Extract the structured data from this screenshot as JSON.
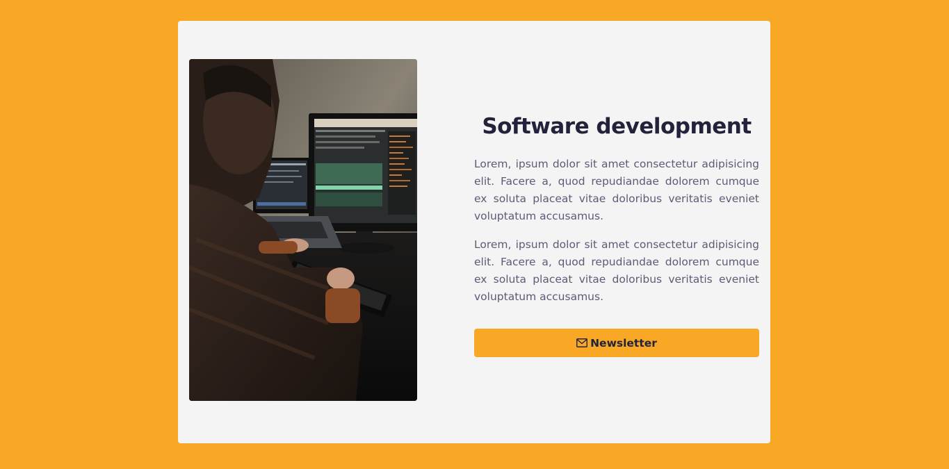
{
  "card": {
    "title": "Software development",
    "paragraphs": [
      "Lorem, ipsum dolor sit amet consectetur adipisicing elit. Facere a, quod repudiandae dolorem cumque ex soluta placeat vitae doloribus veritatis eveniet voluptatum accusamus.",
      "Lorem, ipsum dolor sit amet consectetur adipisicing elit. Facere a, quod repudiandae dolorem cumque ex soluta placeat vitae doloribus veritatis eveniet voluptatum accusamus."
    ],
    "button": {
      "label": "Newsletter",
      "icon": "envelope-icon"
    }
  },
  "colors": {
    "background": "#f8a825",
    "card": "#f4f4f4",
    "title": "#22223a",
    "text": "#5b5b77",
    "button": "#f8a825"
  },
  "image": {
    "subject": "man-coding-at-computer-photo"
  }
}
